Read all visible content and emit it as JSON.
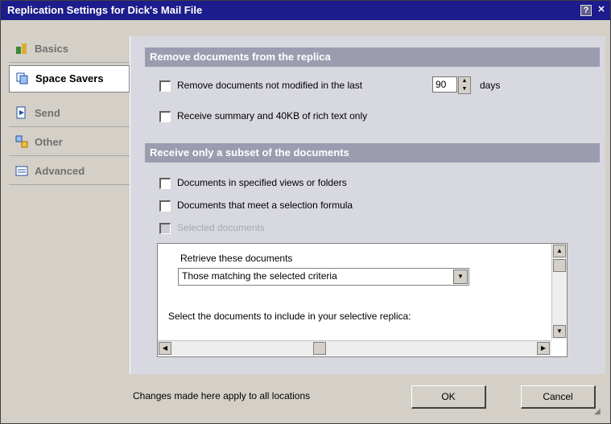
{
  "window": {
    "title": "Replication Settings for Dick's Mail File",
    "help_label": "?",
    "close_label": "✕"
  },
  "sidebar": {
    "items": [
      {
        "label": "Basics",
        "icon": "basics-icon",
        "active": false
      },
      {
        "label": "Space Savers",
        "icon": "space-savers-icon",
        "active": true
      },
      {
        "label": "Send",
        "icon": "send-icon",
        "active": false
      },
      {
        "label": "Other",
        "icon": "other-icon",
        "active": false
      },
      {
        "label": "Advanced",
        "icon": "advanced-icon",
        "active": false
      }
    ]
  },
  "remove_section": {
    "title": "Remove documents from the replica",
    "remove_old_label": "Remove documents not modified in the last",
    "remove_old_checked": false,
    "days_value": "90",
    "days_label": "days",
    "summary_label": "Receive summary and 40KB of rich text only",
    "summary_checked": false
  },
  "subset_section": {
    "title": "Receive only a subset of the documents",
    "views_label": "Documents in specified views or folders",
    "views_checked": false,
    "formula_label": "Documents that meet a selection formula",
    "formula_checked": false,
    "selected_label": "Selected documents",
    "selected_enabled": false
  },
  "criteria": {
    "retrieve_label": "Retrieve these documents",
    "retrieve_value": "Those matching the selected criteria",
    "hint": "Select the documents to include in your selective replica:"
  },
  "footer": {
    "note": "Changes made here apply to all locations",
    "ok_label": "OK",
    "cancel_label": "Cancel"
  },
  "colors": {
    "titlebar": "#1c1c8c",
    "section_header": "#9c9cb0",
    "panel": "#d8d8e0"
  }
}
